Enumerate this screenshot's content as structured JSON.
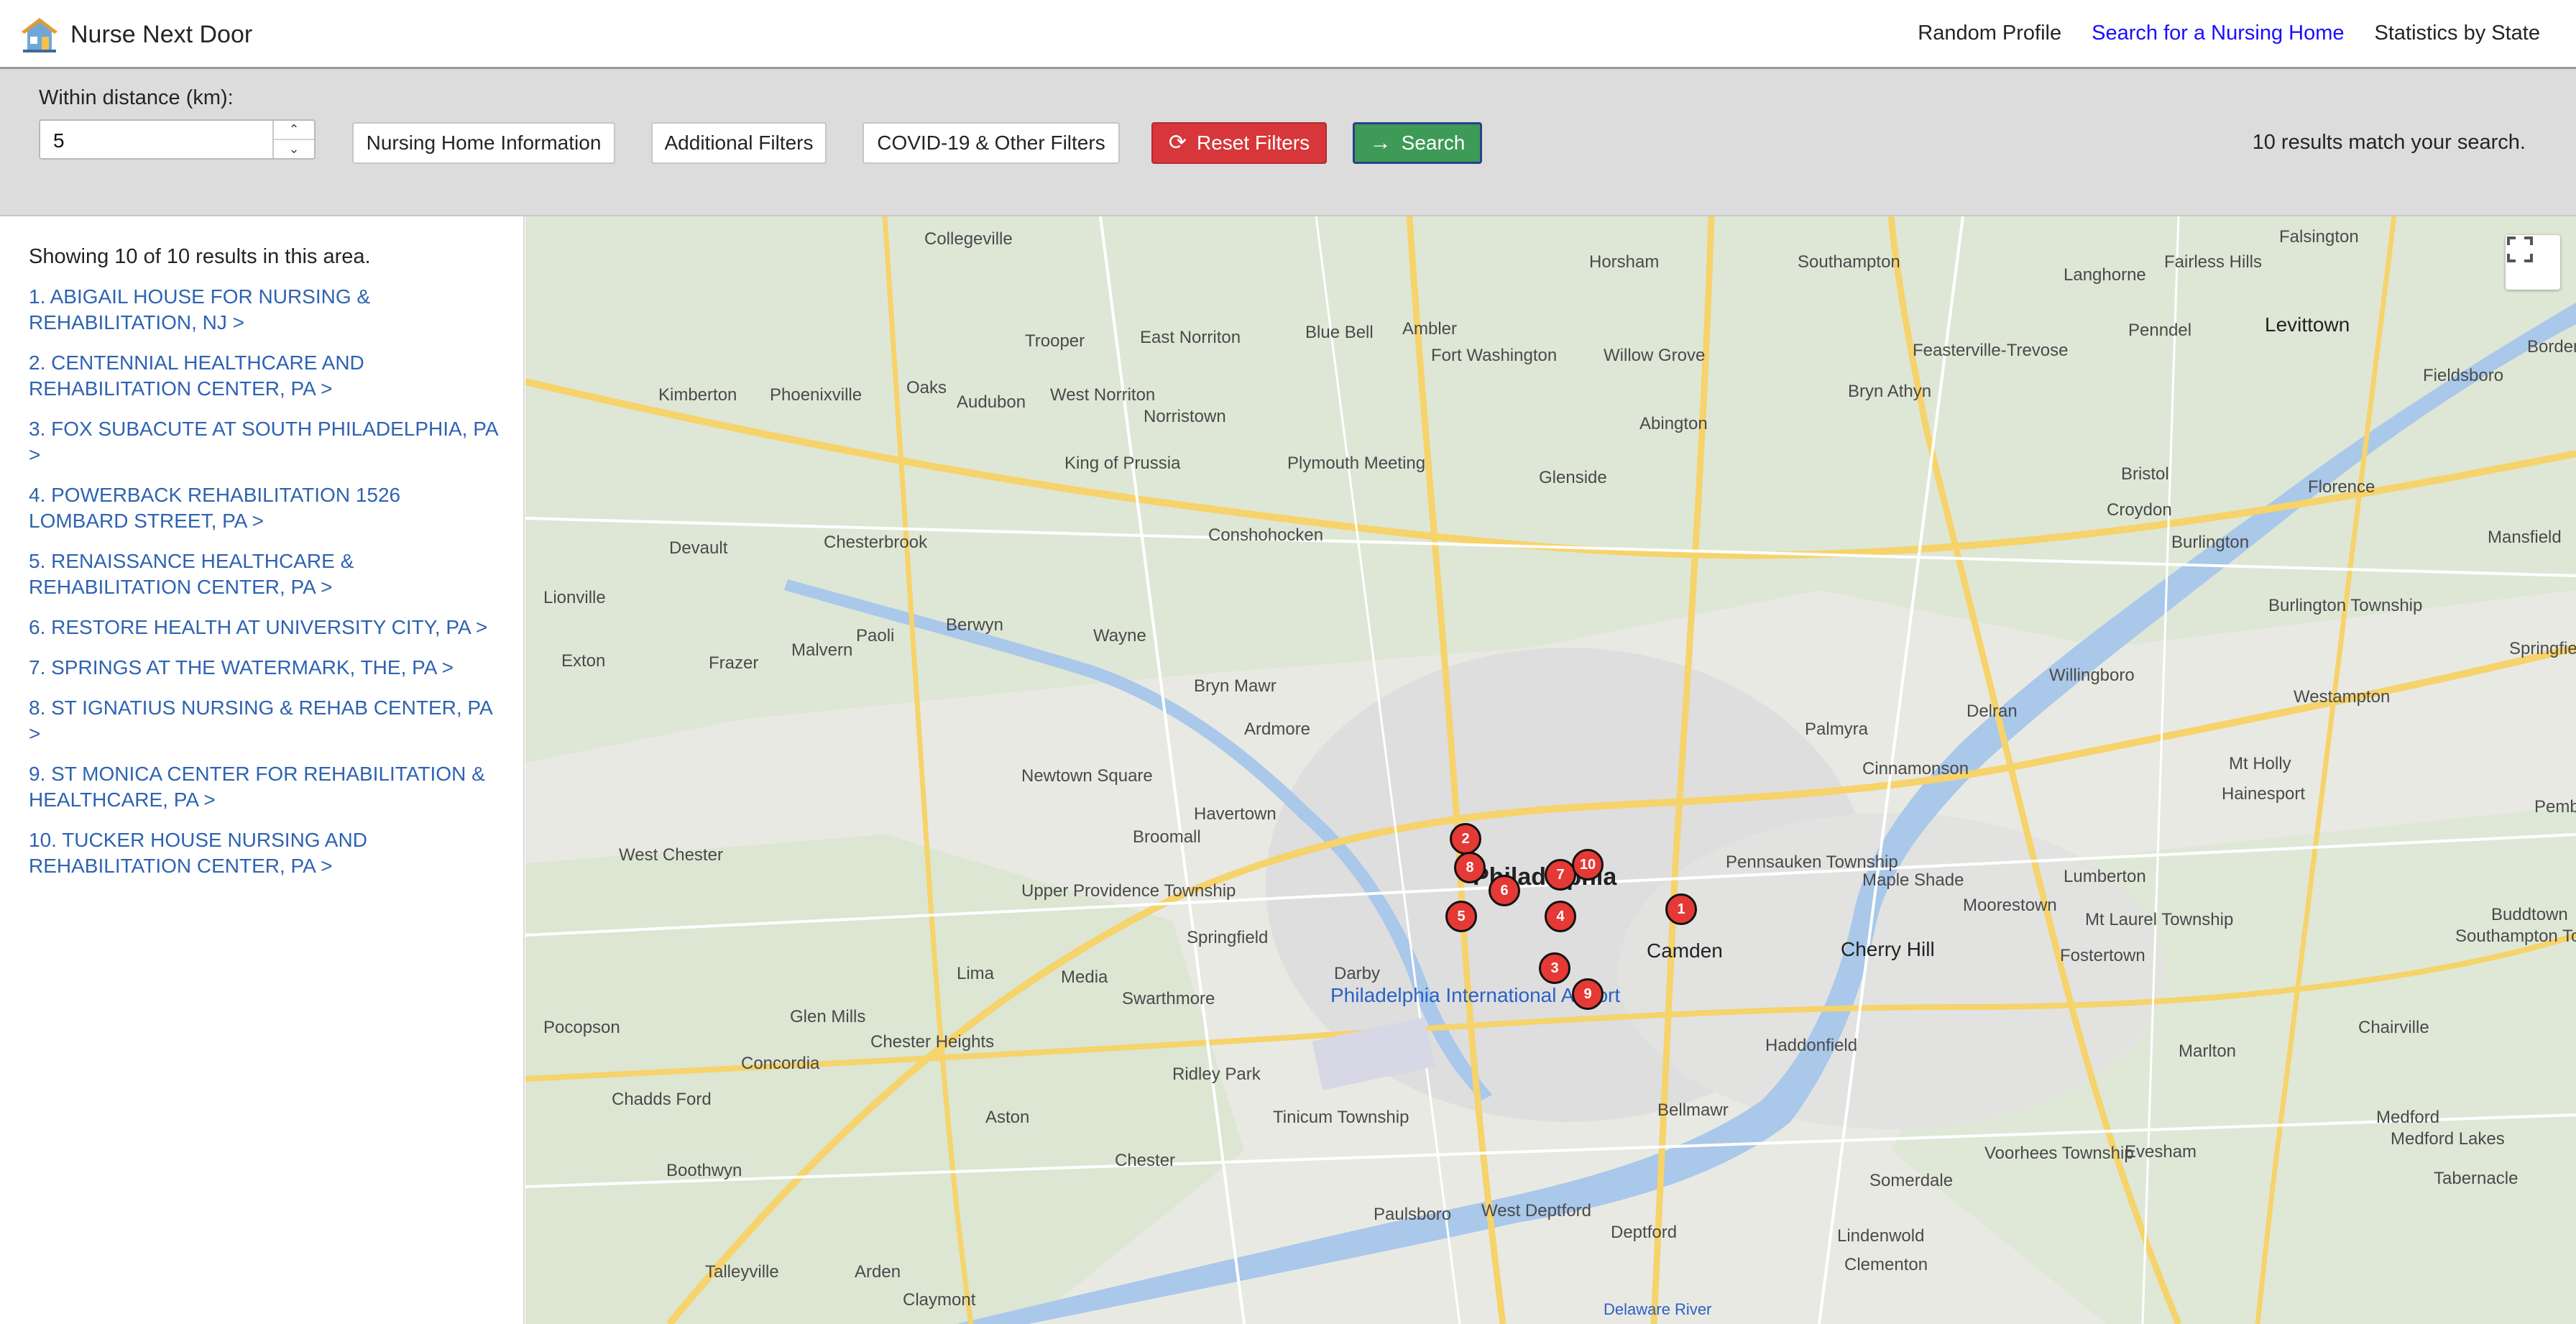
{
  "navbar": {
    "brand": "Nurse Next Door",
    "links": [
      "Random Profile",
      "Search for a Nursing Home",
      "Statistics by State"
    ]
  },
  "filters": {
    "distance_label": "Within distance (km):",
    "distance_value": "5",
    "info_button": "Nursing Home Information",
    "additional_button": "Additional Filters",
    "covid_button": "COVID-19 & Other Filters",
    "reset_button": "Reset Filters",
    "search_button": "Search",
    "result_count": "10 results match your search."
  },
  "sidebar": {
    "showing": "Showing 10 of 10 results in this area.",
    "results": [
      "1. ABIGAIL HOUSE FOR NURSING & REHABILITATION, NJ >",
      "2. CENTENNIAL HEALTHCARE AND REHABILITATION CENTER, PA >",
      "3. FOX SUBACUTE AT SOUTH PHILADELPHIA, PA >",
      "4. POWERBACK REHABILITATION 1526 LOMBARD STREET, PA >",
      "5. RENAISSANCE HEALTHCARE & REHABILITATION CENTER, PA >",
      "6. RESTORE HEALTH AT UNIVERSITY CITY, PA >",
      "7. SPRINGS AT THE WATERMARK, THE, PA >",
      "8. ST IGNATIUS NURSING & REHAB CENTER, PA >",
      "9. ST MONICA CENTER FOR REHABILITATION & HEALTHCARE, PA >",
      "10. TUCKER HOUSE NURSING AND REHABILITATION CENTER, PA >"
    ]
  },
  "map": {
    "city": "Philadelphia",
    "markers": [
      "1",
      "2",
      "3",
      "4",
      "5",
      "6",
      "7",
      "8",
      "9",
      "10"
    ],
    "labels": [
      "Norristown",
      "King of Prussia",
      "Conshohocken",
      "Wayne",
      "Bryn Mawr",
      "Ardmore",
      "Havertown",
      "Springfield",
      "Media",
      "Chester",
      "Camden",
      "Cherry Hill",
      "Willingboro",
      "Levittown",
      "Bristol",
      "Haddonfield",
      "Pennsauken Township",
      "Glenside",
      "Abington",
      "Plymouth Meeting",
      "Ridley Park",
      "Swarthmore",
      "Darby",
      "Lima",
      "Aston",
      "West Chester",
      "Exton",
      "Malvern",
      "Paoli",
      "Berwyn",
      "Newtown Square",
      "Broomall",
      "Moorestown",
      "Mt Laurel Township",
      "Voorhees Township",
      "Bellmawr",
      "Deptford",
      "Paulsboro",
      "West Deptford",
      "Tinicum Township",
      "Glen Mills",
      "Concordia",
      "Chadds Ford",
      "Kimberton",
      "Phoenixville",
      "Oaks",
      "Audubon",
      "West Norriton",
      "Collegeville",
      "Trooper",
      "East Norriton",
      "Blue Bell",
      "Fort Washington",
      "Ambler",
      "Horsham",
      "Willow Grove",
      "Bryn Athyn",
      "Feasterville-Trevose",
      "Southampton",
      "Langhorne",
      "Penndel",
      "Fairless Hills",
      "Falsington",
      "Croydon",
      "Florence",
      "Burlington",
      "Delran",
      "Palmyra",
      "Cinnamonson",
      "Maple Shade",
      "Lumberton",
      "Fostertown",
      "Hainesport",
      "Mt Holly",
      "Westampton",
      "Evesham",
      "Marlton",
      "Somerdale",
      "Lindenwold",
      "Clementon",
      "Pocopson",
      "Chester Heights",
      "Upper Providence Township",
      "Devault",
      "Chesterbrook",
      "Frazer",
      "Lionville",
      "Boothwyn",
      "Arden",
      "Talleyville",
      "Claymont",
      "Medford",
      "Medford Lakes",
      "Tabernacle",
      "Chairville",
      "Buddtown",
      "Southampton Township",
      "Pemberton",
      "Bordentown",
      "Fieldsboro",
      "Mansfield",
      "Springfield",
      "Burlington Township"
    ],
    "water_labels": [
      "Philadelphia International Airport",
      "Delaware River"
    ]
  },
  "colors": {
    "marker": "#e53935",
    "reset": "#d7373a",
    "search": "#3e9a57",
    "link": "#2f63b2",
    "active_nav": "#1a0dff"
  }
}
